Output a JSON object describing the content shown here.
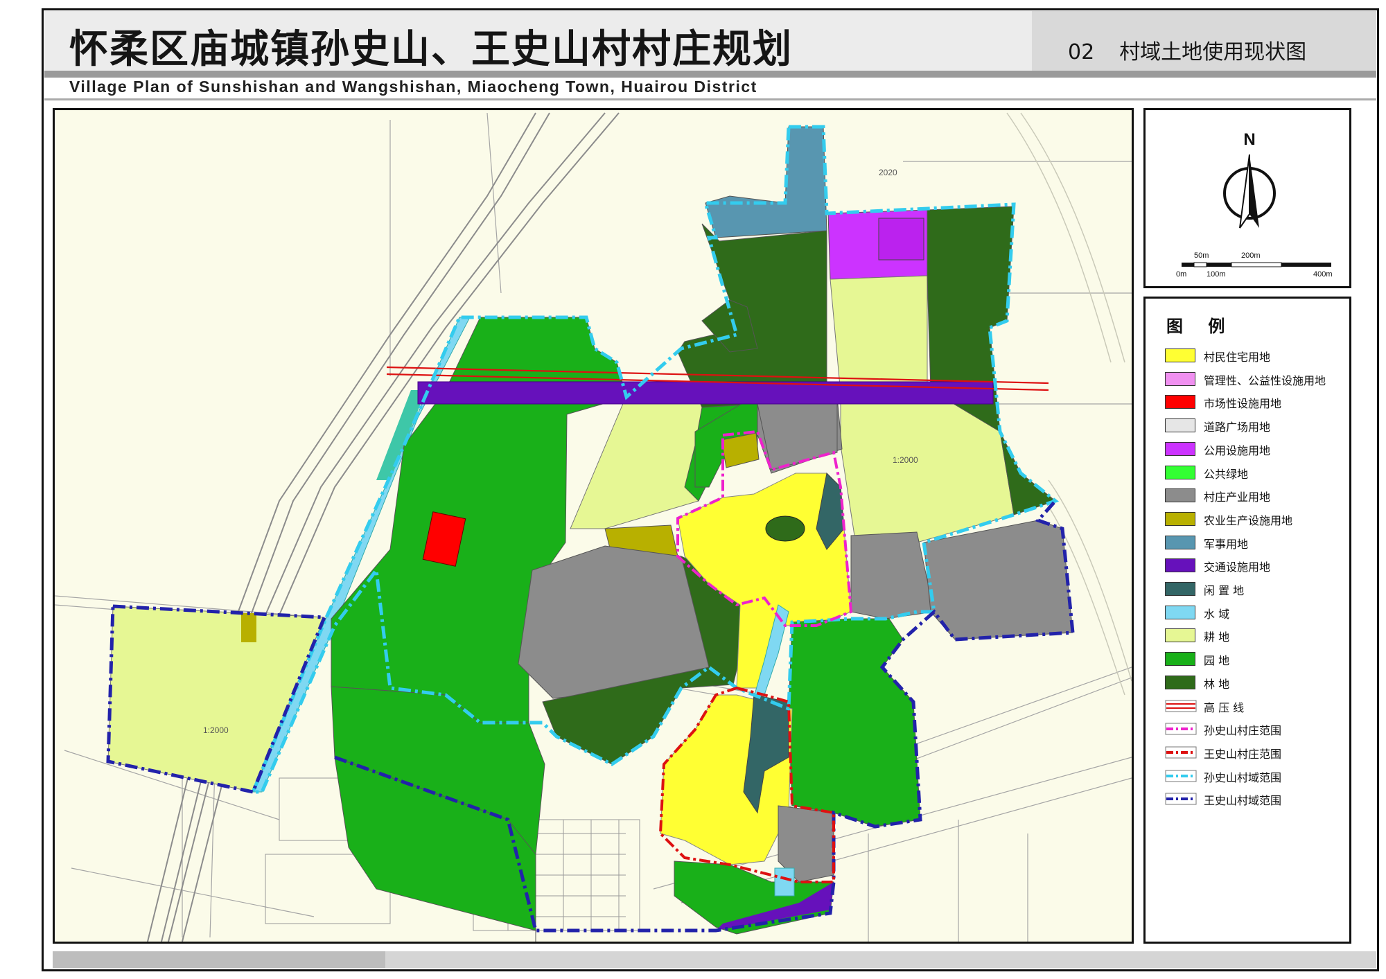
{
  "title": {
    "cn": "怀柔区庙城镇孙史山、王史山村村庄规划",
    "number": "02",
    "subtitle": "村域土地使用现状图",
    "en": "Village Plan of Sunshishan and Wangshishan, Miaocheng Town, Huairou District"
  },
  "north_arrow": {
    "letter": "N",
    "icon": "north-arrow-icon"
  },
  "scale_bar": {
    "top_labels": [
      "50m",
      "200m"
    ],
    "bottom_labels": [
      "0m",
      "100m",
      "400m"
    ]
  },
  "legend": {
    "title": "图  例",
    "items": [
      {
        "label": "村民住宅用地",
        "color": "#ffff33",
        "kind": "fill"
      },
      {
        "label": "管理性、公益性设施用地",
        "color": "#f090f0",
        "kind": "fill"
      },
      {
        "label": "市场性设施用地",
        "color": "#ff0000",
        "kind": "fill"
      },
      {
        "label": "道路广场用地",
        "color": "#e6e6e6",
        "kind": "fill"
      },
      {
        "label": "公用设施用地",
        "color": "#cc33ff",
        "kind": "fill"
      },
      {
        "label": "公共绿地",
        "color": "#33ff33",
        "kind": "fill"
      },
      {
        "label": "村庄产业用地",
        "color": "#8c8c8c",
        "kind": "fill"
      },
      {
        "label": "农业生产设施用地",
        "color": "#b8b000",
        "kind": "fill"
      },
      {
        "label": "军事用地",
        "color": "#5896b0",
        "kind": "fill"
      },
      {
        "label": "交通设施用地",
        "color": "#6611bb",
        "kind": "fill"
      },
      {
        "label": "闲 置 地",
        "color": "#336666",
        "kind": "fill"
      },
      {
        "label": "水    域",
        "color": "#7fd8f2",
        "kind": "fill"
      },
      {
        "label": "耕    地",
        "color": "#e6f794",
        "kind": "fill"
      },
      {
        "label": "园    地",
        "color": "#19b019",
        "kind": "fill"
      },
      {
        "label": "林    地",
        "color": "#2f6b1a",
        "kind": "fill"
      },
      {
        "label": "高 压 线",
        "color": "#dd1111",
        "kind": "double-line"
      },
      {
        "label": "孙史山村庄范围",
        "color": "#ee22cc",
        "kind": "dashdot"
      },
      {
        "label": "王史山村庄范围",
        "color": "#dd1111",
        "kind": "dashdot"
      },
      {
        "label": "孙史山村域范围",
        "color": "#33ccee",
        "kind": "dashdot"
      },
      {
        "label": "王史山村域范围",
        "color": "#2222aa",
        "kind": "dashdot"
      }
    ]
  },
  "map_labels": [
    "2020",
    "1:2000",
    "1:2000"
  ],
  "colors": {
    "background": "#fbfbe9",
    "basemap_lines": "#9a9a9a",
    "residential": "#ffff33",
    "orchard": "#19b019",
    "forest": "#2f6b1a",
    "cropland": "#e6f794",
    "industry": "#8c8c8c",
    "military": "#5896b0",
    "utility": "#cc33ff",
    "transport": "#6611bb",
    "idle": "#336666",
    "water": "#7fd8f2",
    "market": "#ff0000",
    "agri_facility": "#b8b000"
  }
}
